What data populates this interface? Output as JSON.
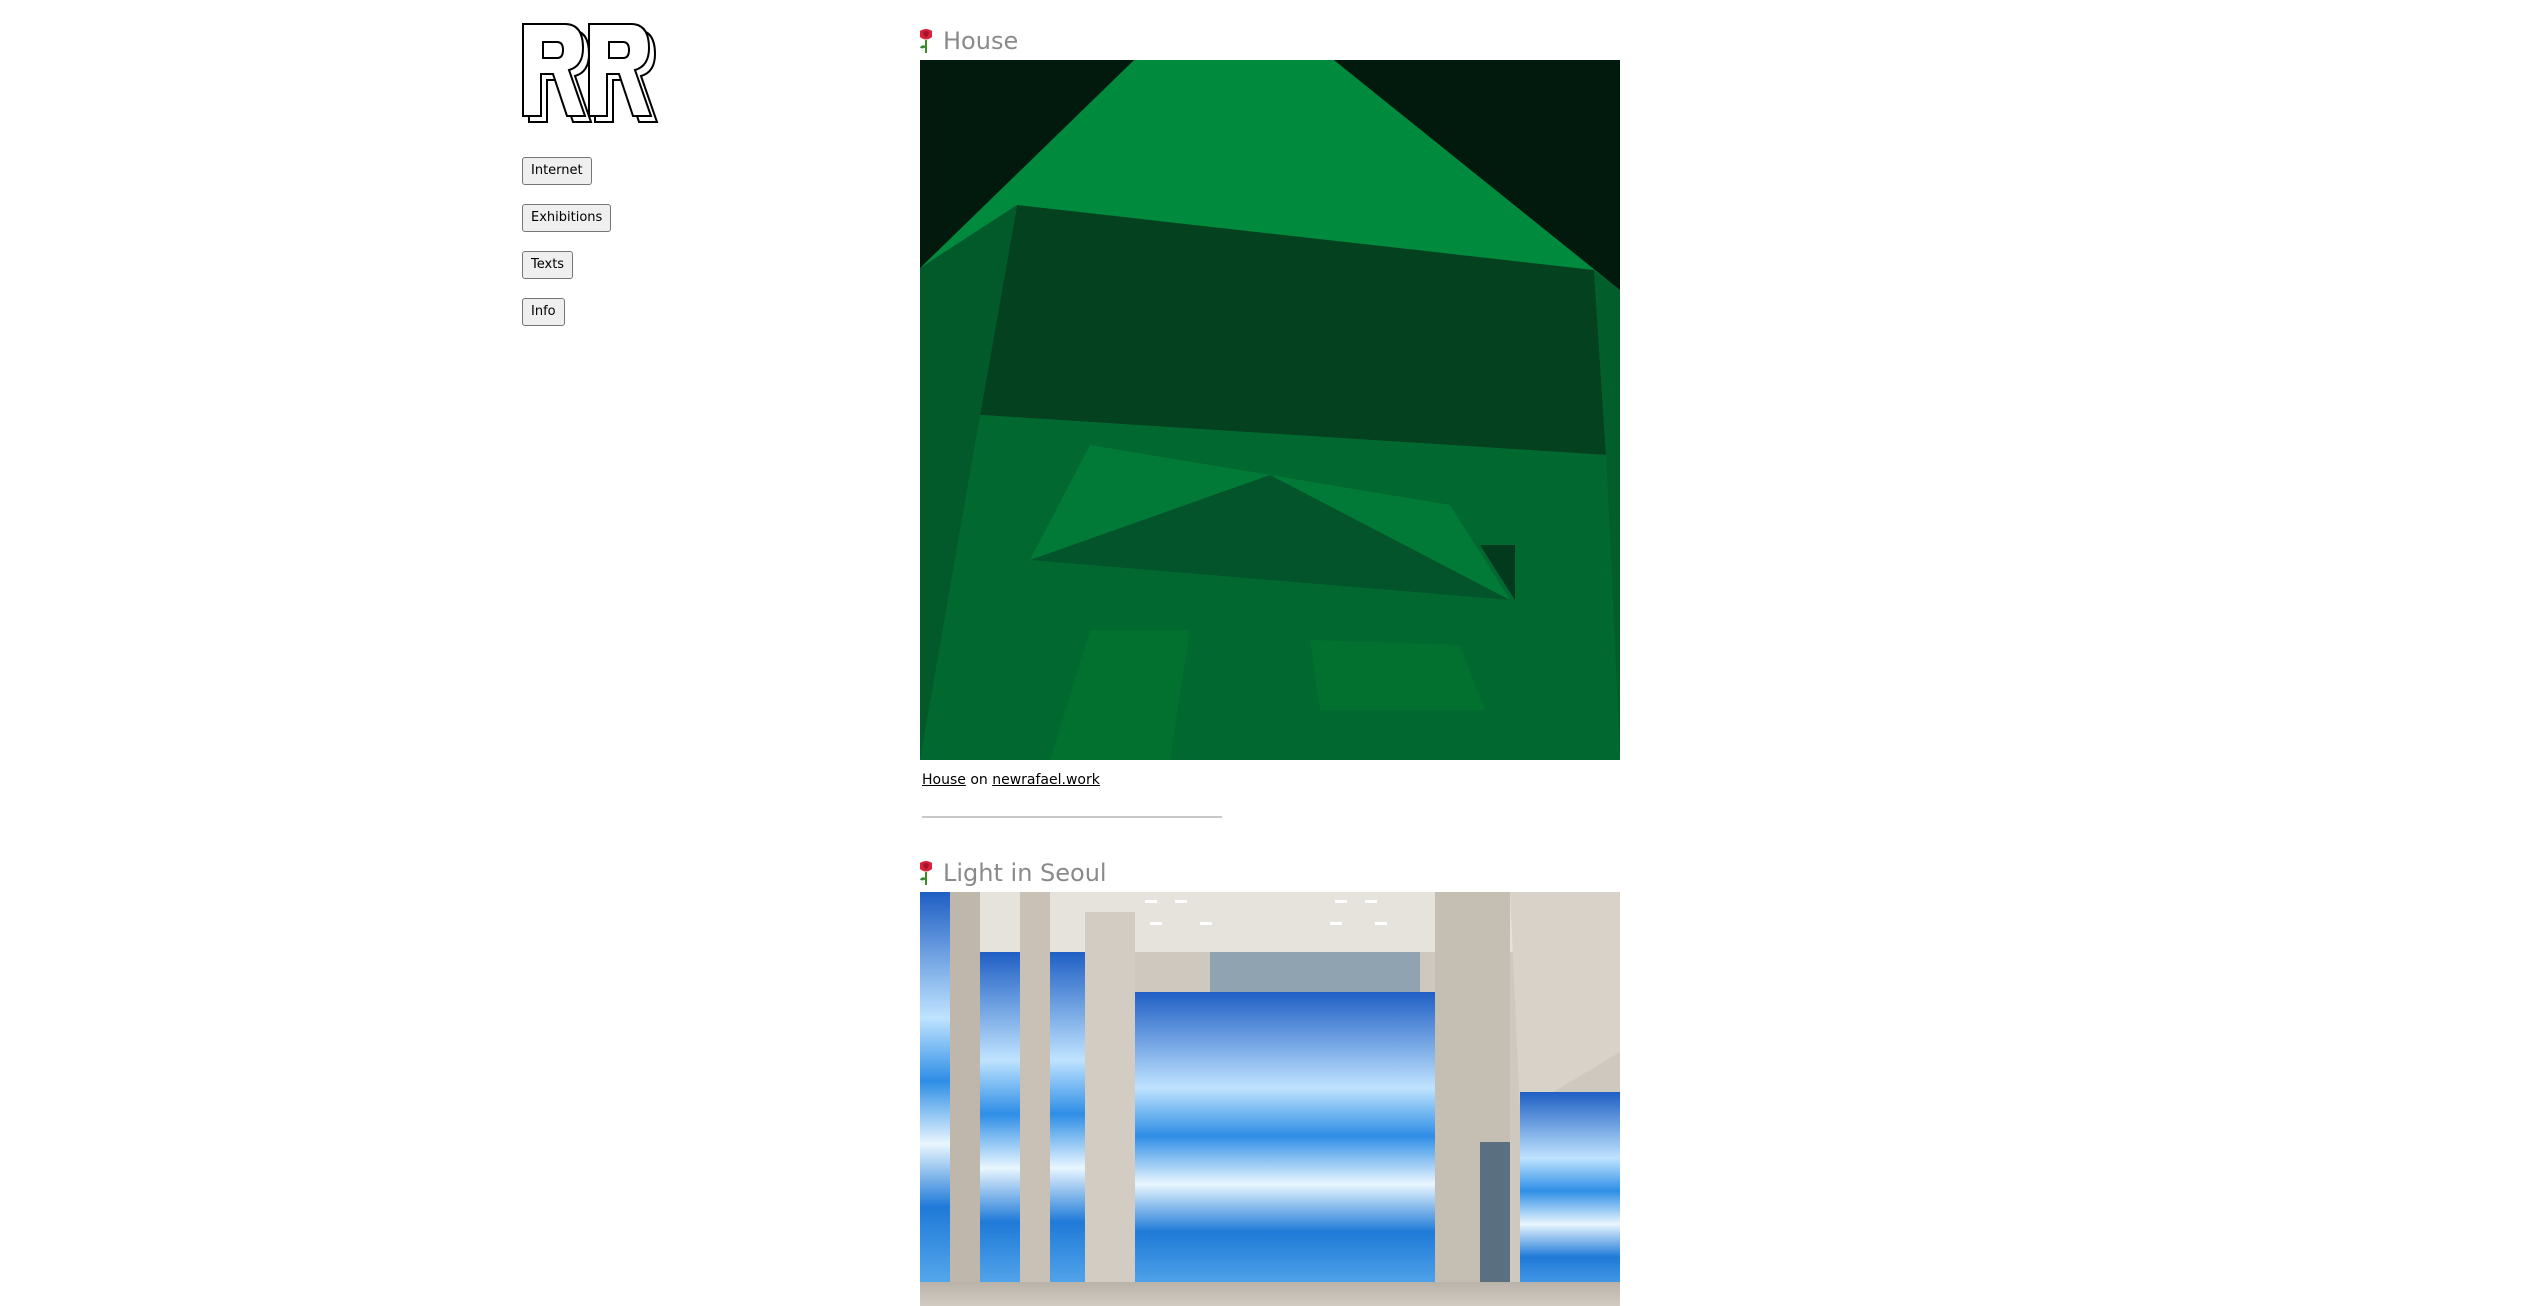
{
  "nav": {
    "items": [
      {
        "label": "Internet"
      },
      {
        "label": "Exhibitions"
      },
      {
        "label": "Texts"
      },
      {
        "label": "Info"
      }
    ]
  },
  "posts": [
    {
      "title": "House",
      "caption": {
        "link_text": "House",
        "middle": " on ",
        "site_text": "newrafael.work"
      }
    },
    {
      "title": "Light in Seoul"
    }
  ],
  "colors": {
    "title_gray": "#8a8a8a",
    "house_green": "#00803a",
    "house_dark": "#021a0d",
    "seoul_blue": "#2a8fe0"
  },
  "icons": {
    "title_marker": "rose-icon"
  }
}
